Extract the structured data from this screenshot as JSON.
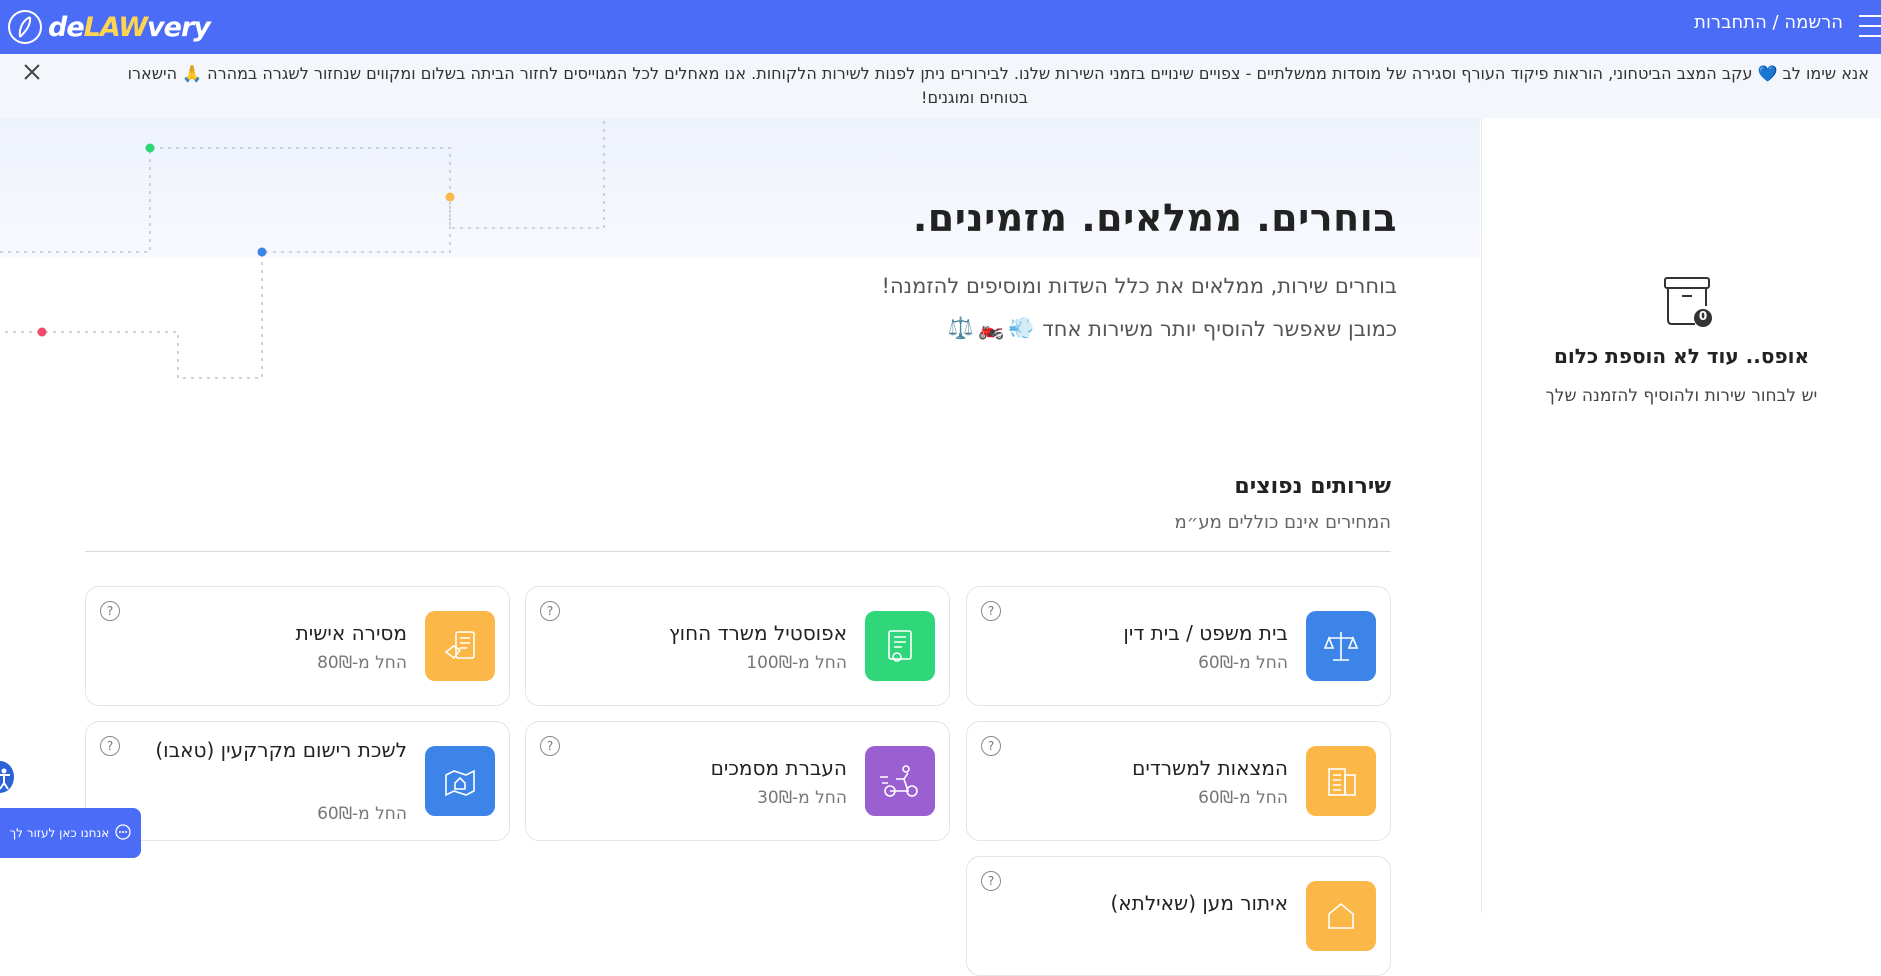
{
  "header": {
    "logo_prefix": "de",
    "logo_law": "LAW",
    "logo_suffix": "very",
    "login_label": "הרשמה / התחברות"
  },
  "notice": {
    "line1": "אנא שימו לב 💙 עקב המצב הביטחוני, הוראות פיקוד העורף וסגירה של מוסדות ממשלתיים - צפויים שינויים בזמני השירות שלנו. לבירורים ניתן לפנות לשירות הלקוחות. אנו מאחלים לכל המגוייסים לחזור הביתה בשלום ומקווים שנחזור לשגרה במהרה 🙏 הישארו",
    "line2": "בטוחים ומוגנים!"
  },
  "hero": {
    "title": "בוחרים. ממלאים. מזמינים.",
    "subtitle": "בוחרים שירות, ממלאים את כלל השדות ומוסיפים להזמנה!",
    "subtitle2": "כמובן שאפשר להוסיף יותר משירות אחד",
    "emojis": [
      "💨",
      "🏍️",
      "⚖️"
    ]
  },
  "cart": {
    "count": "0",
    "title": "אופס.. עוד לא הוספת כלום",
    "subtitle": "יש לבחור שירות ולהוסיף להזמנה שלך"
  },
  "services": {
    "title": "שירותים נפוצים",
    "subtitle": "המחירים אינם כוללים מע״מ",
    "items": [
      {
        "name": "בית משפט / בית דין",
        "price": "החל מ-60₪",
        "color": "#3d84e8",
        "icon": "scales-icon"
      },
      {
        "name": "אפוסטיל משרד החוץ",
        "price": "החל מ-100₪",
        "color": "#2fd67a",
        "icon": "certificate-icon"
      },
      {
        "name": "מסירה אישית",
        "price": "החל מ-80₪",
        "color": "#fbb747",
        "icon": "hand-document-icon"
      },
      {
        "name": "המצאות למשרדים",
        "price": "החל מ-60₪",
        "color": "#fbb747",
        "icon": "office-building-icon"
      },
      {
        "name": "העברת מסמכים",
        "price": "החל מ-30₪",
        "color": "#9a5fd0",
        "icon": "scooter-icon"
      },
      {
        "name": "לשכת רישום מקרקעין (טאבו)",
        "price": "החל מ-60₪",
        "color": "#3d84e8",
        "icon": "map-house-icon"
      },
      {
        "name": "איתור מען (שאילתא)",
        "price": "",
        "color": "#fbb747",
        "icon": "house-search-icon"
      }
    ],
    "help_symbol": "?"
  },
  "chat": {
    "label": "אנחנו כאן לעזור לך"
  }
}
